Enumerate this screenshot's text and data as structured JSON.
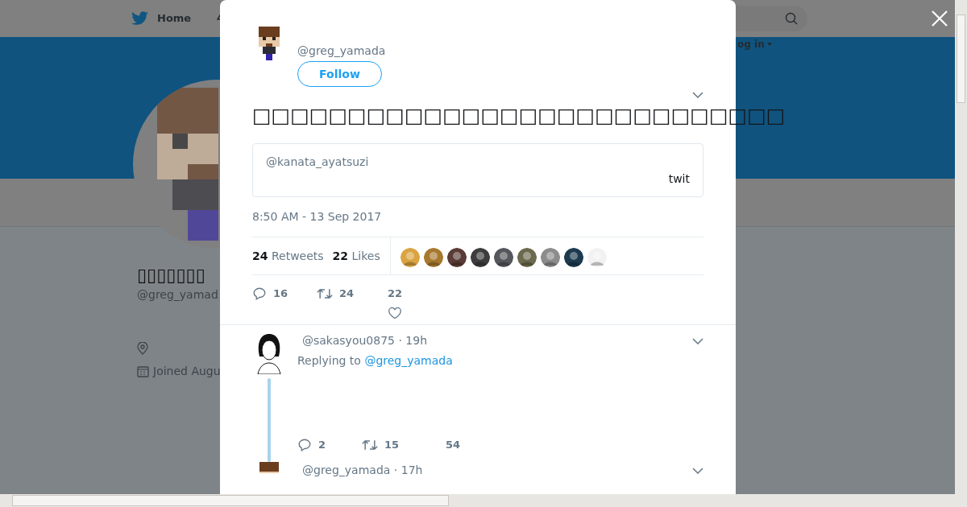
{
  "nav": {
    "home": "Home",
    "login": "og in"
  },
  "profile": {
    "name": "▯▯▯▯▯▯▯",
    "handle": "@greg_yamad",
    "joined": "Joined Augu"
  },
  "tweet": {
    "handle": "@greg_yamada",
    "follow": "Follow",
    "text": "□□□□□□□□□□□□□□□□□□□□□□□□□□□□",
    "quote": {
      "handle": "@kanata_ayatsuzi",
      "text": "twit"
    },
    "time": "8:50 AM - 13 Sep 2017",
    "retweets": {
      "count": "24",
      "label": "Retweets"
    },
    "likes": {
      "count": "22",
      "label": "Likes"
    },
    "likers": [
      {
        "color": "#d9a441"
      },
      {
        "color": "#a8782f"
      },
      {
        "color": "#5a3b36"
      },
      {
        "color": "#3d3d3d"
      },
      {
        "color": "#55575c"
      },
      {
        "color": "#6c6a4e"
      },
      {
        "color": "#8c8c8c"
      },
      {
        "color": "#1d3a4f"
      },
      {
        "color": "#f2f2f2"
      }
    ],
    "actions": {
      "replies": "16",
      "retweets": "24",
      "likes": "22"
    }
  },
  "replies": [
    {
      "handle": "@sakasyou0875",
      "time": "· 19h",
      "replying_label": "Replying to",
      "replying_to": "@greg_yamada",
      "replies": "2",
      "retweets": "15",
      "likes": "54",
      "thread": true
    },
    {
      "handle": "@greg_yamada",
      "time": "· 17h",
      "thread": false
    }
  ]
}
